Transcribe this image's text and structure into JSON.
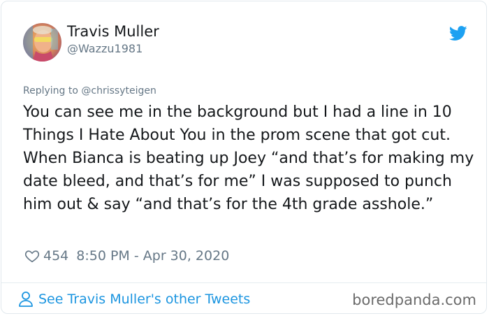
{
  "tweet": {
    "author": {
      "display_name": "Travis Muller",
      "handle": "@Wazzu1981",
      "avatar_icon": "profile-photo"
    },
    "brand_icon": "twitter-bird-icon",
    "brand_color": "#1da1f2",
    "reply_to": "Replying to @chrissyteigen",
    "text": "You can see me in the background but I had a line in 10 Things I Hate About You in the prom scene that got cut. When Bianca is beating up Joey “and that’s for making my date bleed, and that’s for me” I was supposed to punch him out & say “and that’s for the 4th grade asshole.”",
    "likes": "454",
    "timestamp": "8:50 PM - Apr 30, 2020",
    "footer_link": "See Travis Muller's other Tweets",
    "link_color": "#1b95e0"
  },
  "watermark": "boredpanda.com"
}
